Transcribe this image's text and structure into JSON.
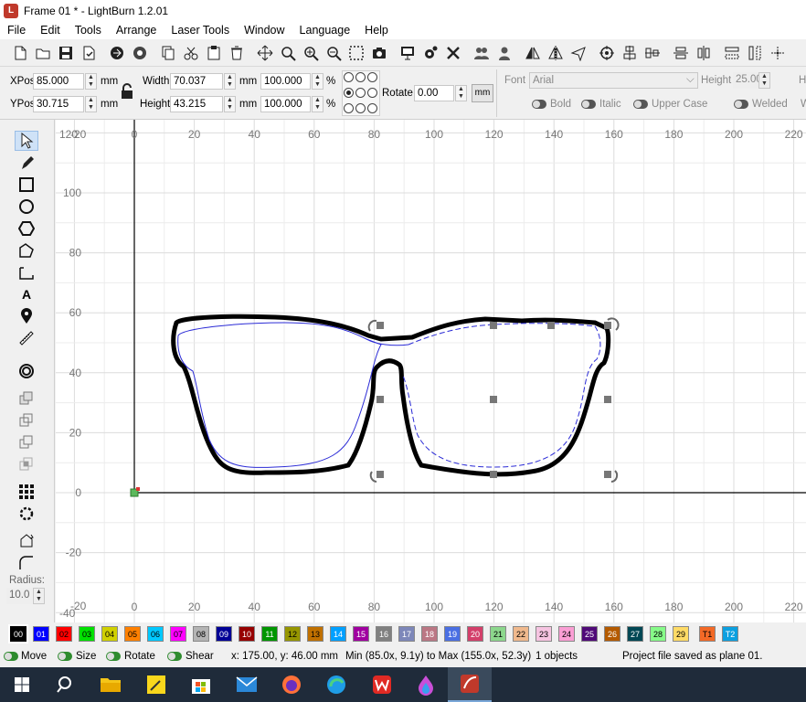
{
  "window": {
    "title": "Frame 01 * - LightBurn 1.2.01"
  },
  "menu": [
    "File",
    "Edit",
    "Tools",
    "Arrange",
    "Laser Tools",
    "Window",
    "Language",
    "Help"
  ],
  "props": {
    "xpos_label": "XPos",
    "xpos": "85.000",
    "ypos_label": "YPos",
    "ypos": "30.715",
    "unit": "mm",
    "width_label": "Width",
    "width": "70.037",
    "height_label": "Height",
    "height": "43.215",
    "scale_w": "100.000",
    "scale_h": "100.000",
    "pct": "%",
    "rotate_label": "Rotate",
    "rotate": "0.00",
    "mm_button": "mm",
    "font_label": "Font",
    "font": "Arial",
    "font_height_label": "Height",
    "font_height": "25.00",
    "h_cut": "H",
    "bold": "Bold",
    "italic": "Italic",
    "upper_case": "Upper Case",
    "welded": "Welded",
    "w_cut": "W"
  },
  "left": {
    "radius_label": "Radius:",
    "radius": "10.0"
  },
  "canvas": {
    "x_ticks": [
      "0",
      "20",
      "40",
      "60",
      "80",
      "100",
      "120",
      "140",
      "160",
      "180",
      "200",
      "220"
    ],
    "y_ticks": [
      "100",
      "80",
      "60",
      "40",
      "20",
      "0",
      "-20"
    ],
    "corner_top": "120",
    "corner_top_cut": "-20",
    "corner_bottom": "-40",
    "corner_bottom_cut": "-20"
  },
  "palette": [
    {
      "l": "00",
      "c": "#000000",
      "t": "#ffffff"
    },
    {
      "l": "01",
      "c": "#0000ff",
      "t": "#ffffff"
    },
    {
      "l": "02",
      "c": "#ff0000",
      "t": "#000000"
    },
    {
      "l": "03",
      "c": "#00e000",
      "t": "#000000"
    },
    {
      "l": "04",
      "c": "#d0d000",
      "t": "#000000"
    },
    {
      "l": "05",
      "c": "#ff8000",
      "t": "#000000"
    },
    {
      "l": "06",
      "c": "#00c8ff",
      "t": "#000000"
    },
    {
      "l": "07",
      "c": "#ff00ff",
      "t": "#000000"
    },
    {
      "l": "08",
      "c": "#b4b4b4",
      "t": "#000000"
    },
    {
      "l": "09",
      "c": "#000096",
      "t": "#ffffff"
    },
    {
      "l": "10",
      "c": "#960000",
      "t": "#ffffff"
    },
    {
      "l": "11",
      "c": "#009600",
      "t": "#ffffff"
    },
    {
      "l": "12",
      "c": "#969600",
      "t": "#000000"
    },
    {
      "l": "13",
      "c": "#c07000",
      "t": "#000000"
    },
    {
      "l": "14",
      "c": "#00a0ff",
      "t": "#ffffff"
    },
    {
      "l": "15",
      "c": "#a000a0",
      "t": "#ffffff"
    },
    {
      "l": "16",
      "c": "#808080",
      "t": "#ffffff"
    },
    {
      "l": "17",
      "c": "#7d87b9",
      "t": "#ffffff"
    },
    {
      "l": "18",
      "c": "#bb7784",
      "t": "#ffffff"
    },
    {
      "l": "19",
      "c": "#4a6fe3",
      "t": "#ffffff"
    },
    {
      "l": "20",
      "c": "#d33f6a",
      "t": "#ffffff"
    },
    {
      "l": "21",
      "c": "#8cd78c",
      "t": "#000000"
    },
    {
      "l": "22",
      "c": "#f0b98d",
      "t": "#000000"
    },
    {
      "l": "23",
      "c": "#f6c4e1",
      "t": "#000000"
    },
    {
      "l": "24",
      "c": "#fa9ed4",
      "t": "#000000"
    },
    {
      "l": "25",
      "c": "#500a78",
      "t": "#ffffff"
    },
    {
      "l": "26",
      "c": "#b45a00",
      "t": "#ffffff"
    },
    {
      "l": "27",
      "c": "#004754",
      "t": "#ffffff"
    },
    {
      "l": "28",
      "c": "#86fa88",
      "t": "#000000"
    },
    {
      "l": "29",
      "c": "#ffdb66",
      "t": "#000000"
    },
    {
      "l": "T1",
      "c": "#f36926",
      "t": "#000000"
    },
    {
      "l": "T2",
      "c": "#0ca0e0",
      "t": "#ffffff"
    }
  ],
  "status": {
    "move": "Move",
    "size": "Size",
    "rotate": "Rotate",
    "shear": "Shear",
    "coords": "x: 175.00, y: 46.00 mm",
    "bounds": "Min (85.0x, 9.1y) to Max (155.0x, 52.3y)",
    "objects": "1 objects",
    "message": "Project file saved as plane 01."
  }
}
